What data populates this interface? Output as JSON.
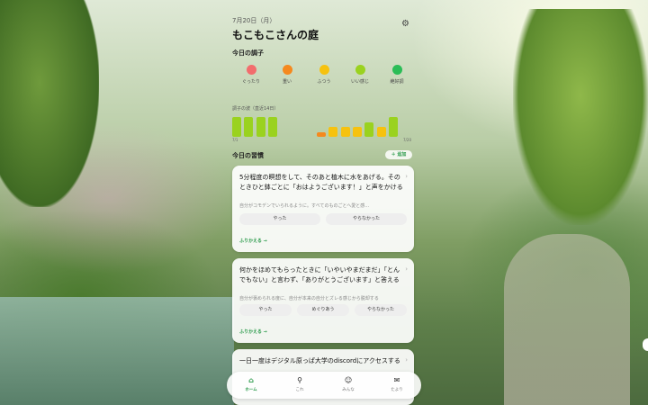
{
  "header": {
    "date": "7月20日（月）",
    "title": "もこもこさんの庭"
  },
  "mood": {
    "heading": "今日の調子",
    "items": [
      {
        "label": "ぐったり",
        "color": "#f26d6d"
      },
      {
        "label": "重い",
        "color": "#f5891e"
      },
      {
        "label": "ふつう",
        "color": "#f6c20f"
      },
      {
        "label": "いい感じ",
        "color": "#9ad21f"
      },
      {
        "label": "絶好調",
        "color": "#2bbd57"
      }
    ]
  },
  "wave": {
    "heading": "調子の波（直近14日）",
    "start_label": "7/1",
    "end_label": "7/20",
    "levels": [
      4,
      4,
      4,
      4,
      0,
      0,
      0,
      1,
      2,
      2,
      2,
      3,
      2,
      4
    ],
    "colors": {
      "1": "#f5891e",
      "2": "#f6c20f",
      "3": "#9ad21f",
      "4": "#9ad21f"
    }
  },
  "habits": {
    "heading": "今日の習慣",
    "add_label": "＋ 追加",
    "items": [
      {
        "text": "5分程度の瞑想をして、そのあと植木に水をあげる。そのときひと鉢ごとに「おはようございます！」と声をかける",
        "sub": "自分がコモデンでいられるように。すべてのものごとへ愛と感…",
        "options": [
          "やった",
          "やらなかった"
        ],
        "reflect": "ふりかえる →"
      },
      {
        "text": "何かをほめてもらったときに「いやいやまだまだ」「とんでもない」と言わず、「ありがとうございます」と答える",
        "sub": "自分が褒められる度に、自分が本来の自分とズレる感じから脱却する",
        "options": [
          "やった",
          "めぐりあう",
          "やらなかった"
        ],
        "reflect": "ふりかえる →"
      },
      {
        "text": "一日一度はデジタル原っぱ大学のdiscordにアクセスする"
      }
    ]
  },
  "nav": [
    {
      "label": "ホーム",
      "icon": "⌂"
    },
    {
      "label": "これ",
      "icon": "⚲"
    },
    {
      "label": "みんな",
      "icon": "☺"
    },
    {
      "label": "たより",
      "icon": "✉"
    }
  ]
}
